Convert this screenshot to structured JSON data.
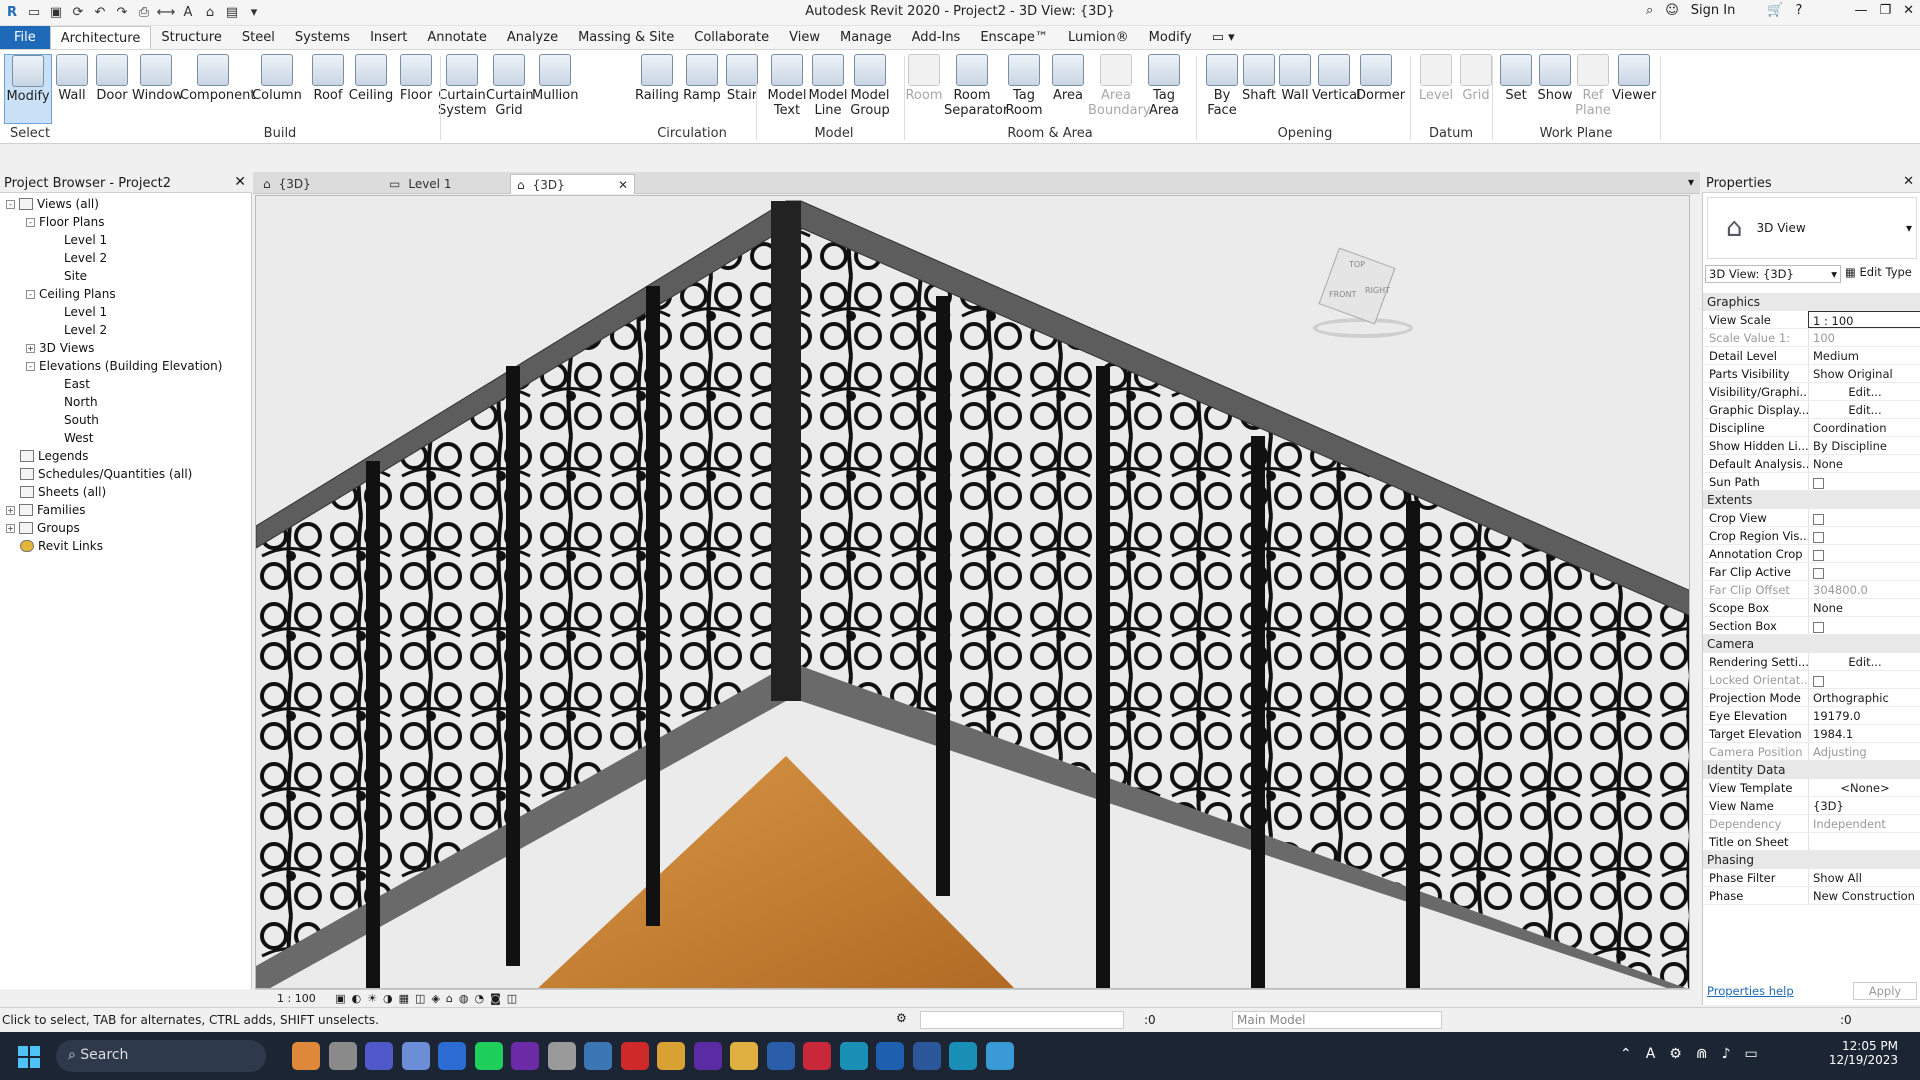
{
  "title_bar": {
    "title": "Autodesk Revit 2020 - Project2 - 3D View: {3D}",
    "sign_in": "Sign In"
  },
  "menu": [
    "File",
    "Architecture",
    "Structure",
    "Steel",
    "Systems",
    "Insert",
    "Annotate",
    "Analyze",
    "Massing & Site",
    "Collaborate",
    "View",
    "Manage",
    "Add-Ins",
    "Enscape™",
    "Lumion®",
    "Modify"
  ],
  "ribbon": {
    "select_label": "Select",
    "build_buttons": [
      "Modify",
      "Wall",
      "Door",
      "Window",
      "Component",
      "Column",
      "Roof",
      "Ceiling",
      "Floor",
      "Curtain System",
      "Curtain Grid",
      "Mullion"
    ],
    "circulation_buttons": [
      "Railing",
      "Ramp",
      "Stair"
    ],
    "model_buttons": [
      "Model Text",
      "Model Line",
      "Model Group"
    ],
    "room_buttons": [
      "Room",
      "Room Separator",
      "Tag Room",
      "Area",
      "Area Boundary",
      "Tag Area"
    ],
    "opening_buttons": [
      "By Face",
      "Shaft",
      "Wall",
      "Vertical",
      "Dormer"
    ],
    "datum_buttons": [
      "Level",
      "Grid"
    ],
    "workplane_buttons": [
      "Set",
      "Show",
      "Ref Plane",
      "Viewer"
    ],
    "panels": [
      "Build",
      "Circulation",
      "Model",
      "Room & Area",
      "Opening",
      "Datum",
      "Work Plane"
    ]
  },
  "project_browser": {
    "title": "Project Browser - Project2",
    "tree": [
      "Views (all)",
      "Floor Plans",
      "Level 1",
      "Level 2",
      "Site",
      "Ceiling Plans",
      "Level 1",
      "Level 2",
      "3D Views",
      "Elevations (Building Elevation)",
      "East",
      "North",
      "South",
      "West",
      "Legends",
      "Schedules/Quantities (all)",
      "Sheets (all)",
      "Families",
      "Groups",
      "Revit Links"
    ]
  },
  "view_tabs": [
    "{3D}",
    "Level 1",
    "{3D}"
  ],
  "view_scale_bar": "1 : 100",
  "viewcube": {
    "top": "TOP",
    "front": "FRONT",
    "right": "RIGHT"
  },
  "properties": {
    "title": "Properties",
    "type_name": "3D View",
    "selector": "3D View: {3D}",
    "edit_type": "Edit Type",
    "groups": {
      "graphics": "Graphics",
      "extents": "Extents",
      "camera": "Camera",
      "identity": "Identity Data",
      "phasing": "Phasing"
    },
    "rows": {
      "view_scale": [
        "View Scale",
        "1 : 100"
      ],
      "scale_value": [
        "Scale Value 1:",
        "100"
      ],
      "detail_level": [
        "Detail Level",
        "Medium"
      ],
      "parts_visibility": [
        "Parts Visibility",
        "Show Original"
      ],
      "vis_graphics": [
        "Visibility/Graphi...",
        "Edit..."
      ],
      "graphic_display": [
        "Graphic Display...",
        "Edit..."
      ],
      "discipline": [
        "Discipline",
        "Coordination"
      ],
      "show_hidden": [
        "Show Hidden Li...",
        "By Discipline"
      ],
      "default_analysis": [
        "Default Analysis...",
        "None"
      ],
      "sun_path": [
        "Sun Path",
        ""
      ],
      "crop_view": [
        "Crop View",
        ""
      ],
      "crop_region": [
        "Crop Region Vis...",
        ""
      ],
      "annotation_crop": [
        "Annotation Crop",
        ""
      ],
      "far_clip_active": [
        "Far Clip Active",
        ""
      ],
      "far_clip_offset": [
        "Far Clip Offset",
        "304800.0"
      ],
      "scope_box": [
        "Scope Box",
        "None"
      ],
      "section_box": [
        "Section Box",
        ""
      ],
      "rendering": [
        "Rendering Setti...",
        "Edit..."
      ],
      "locked": [
        "Locked Orientat...",
        ""
      ],
      "projection": [
        "Projection Mode",
        "Orthographic"
      ],
      "eye_elev": [
        "Eye Elevation",
        "19179.0"
      ],
      "target_elev": [
        "Target Elevation",
        "1984.1"
      ],
      "camera_pos": [
        "Camera Position",
        "Adjusting"
      ],
      "view_template": [
        "View Template",
        "<None>"
      ],
      "view_name": [
        "View Name",
        "{3D}"
      ],
      "dependency": [
        "Dependency",
        "Independent"
      ],
      "title_on_sheet": [
        "Title on Sheet",
        ""
      ],
      "phase_filter": [
        "Phase Filter",
        "Show All"
      ],
      "phase": [
        "Phase",
        "New Construction"
      ]
    },
    "help": "Properties help",
    "apply": "Apply"
  },
  "status": {
    "hint": "Click to select, TAB for alternates, CTRL adds, SHIFT unselects.",
    "worksets": ":0",
    "model": "Main Model",
    "filter": ":0"
  },
  "taskbar": {
    "search": "Search",
    "time": "12:05 PM",
    "date": "12/19/2023"
  }
}
